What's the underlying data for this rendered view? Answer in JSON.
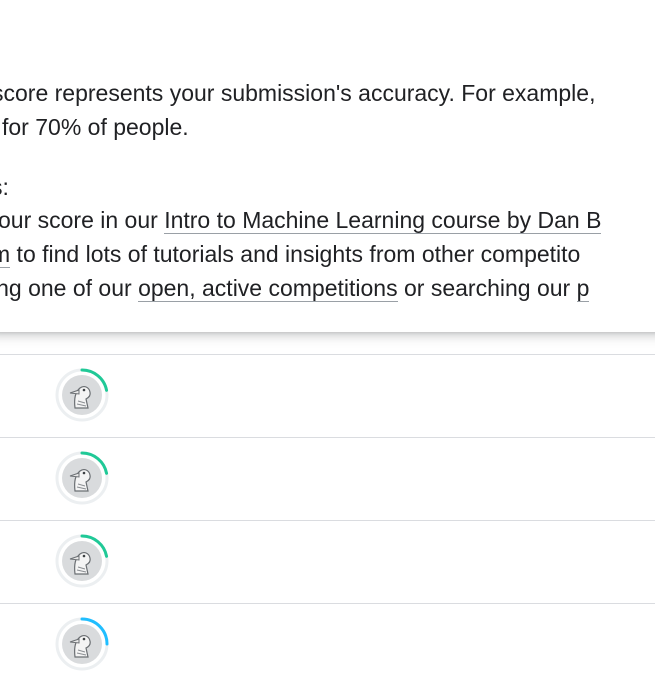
{
  "popup": {
    "line1": "score represents your submission's accuracy. For example,",
    "line2": "for 70% of people.",
    "line3": "s:",
    "line4_before": "our score in our ",
    "line4_link": "Intro to Machine Learning course by Dan B",
    "line5_link": "m",
    "line5_after": " to find lots of tutorials and insights from other competito",
    "line6_before": "ing one of our ",
    "line6_link": "open, active competitions",
    "line6_after": " or searching our ",
    "line6_tail_link": "p"
  },
  "rows": [
    {
      "progress_color": "#20c997",
      "progress": 0.22
    },
    {
      "progress_color": "#20c997",
      "progress": 0.22
    },
    {
      "progress_color": "#20c997",
      "progress": 0.22
    },
    {
      "progress_color": "#20beff",
      "progress": 0.25
    }
  ],
  "icons": {
    "avatar": "duck-avatar-icon"
  }
}
